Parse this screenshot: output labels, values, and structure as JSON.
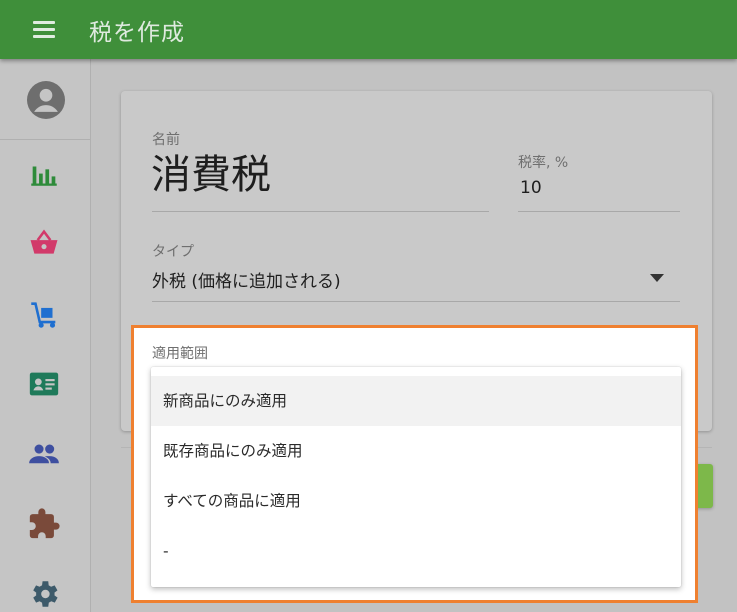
{
  "appbar": {
    "title": "税を作成",
    "menu_icon": "menu-icon"
  },
  "sidebar": {
    "avatar_icon": "account-circle-icon",
    "items": [
      {
        "icon": "bar-chart-icon",
        "color": "#2e8b3a"
      },
      {
        "icon": "basket-icon",
        "color": "#d23a6a"
      },
      {
        "icon": "hand-truck-icon",
        "color": "#1f6fd0"
      },
      {
        "icon": "contact-card-icon",
        "color": "#1f7a5a"
      },
      {
        "icon": "people-icon",
        "color": "#3e4fa0"
      },
      {
        "icon": "puzzle-icon",
        "color": "#7a4a3a"
      },
      {
        "icon": "gear-icon",
        "color": "#3d5a6a"
      }
    ]
  },
  "form": {
    "name_label": "名前",
    "name_value": "消費税",
    "rate_label": "税率, %",
    "rate_value": "10",
    "type_label": "タイプ",
    "type_value": "外税 (価格に追加される)",
    "scope_label": "適用範囲"
  },
  "dropdown": {
    "options": [
      "新商品にのみ適用",
      "既存商品にのみ適用",
      "すべての商品に適用",
      "-"
    ],
    "highlighted_index": 0
  },
  "colors": {
    "appbar": "#3f8f3a",
    "highlight_border": "#ef8030",
    "primary_button": "#7db84a"
  }
}
